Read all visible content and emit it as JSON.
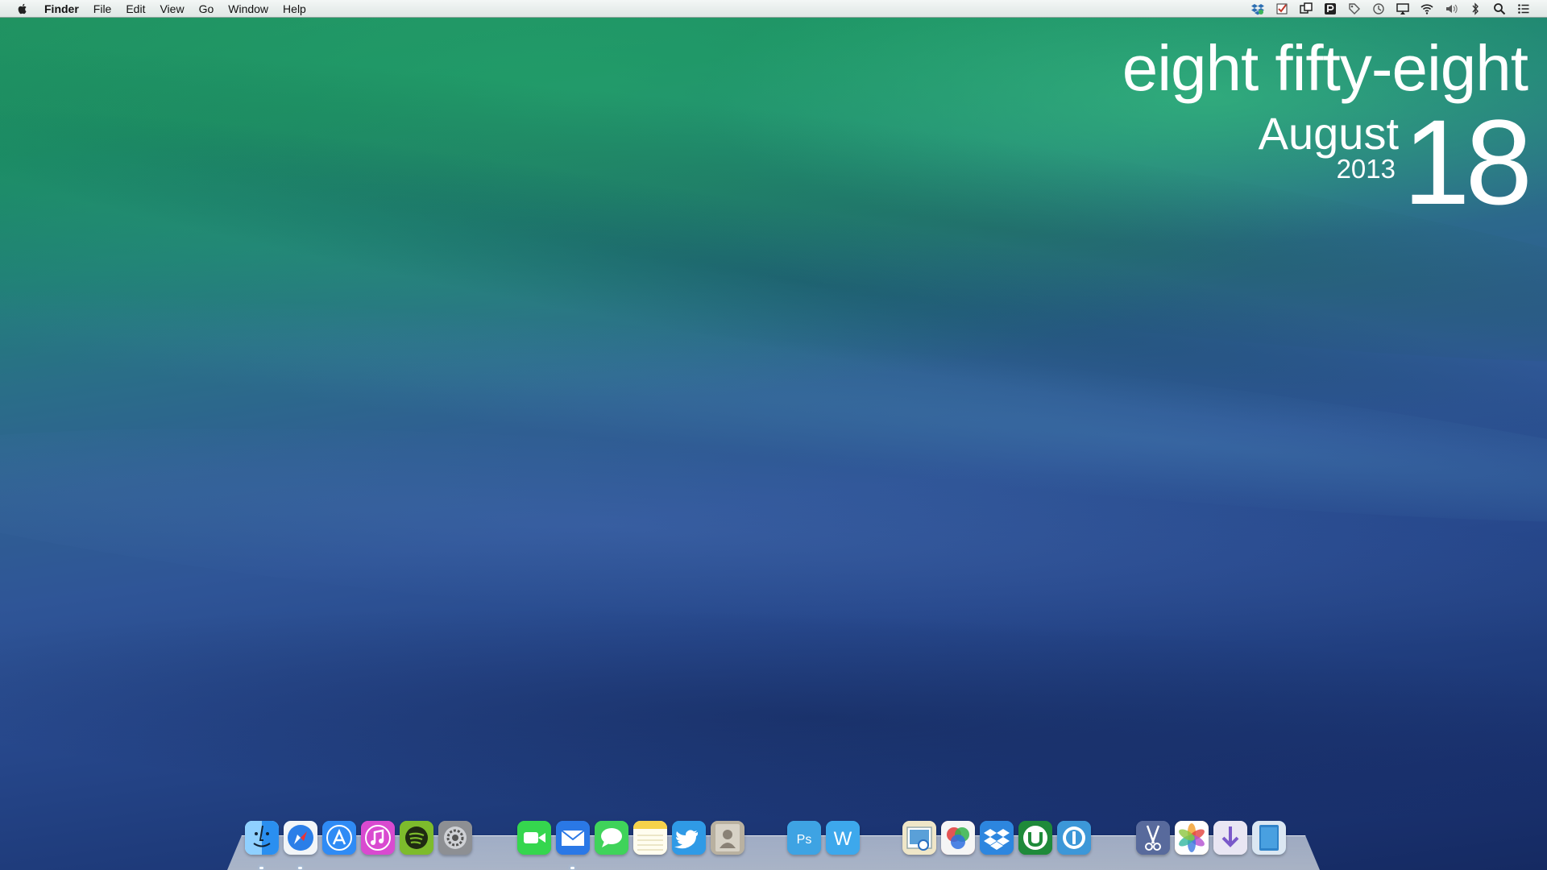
{
  "menubar": {
    "apple_icon": "apple-icon",
    "app_name": "Finder",
    "menus": [
      "File",
      "Edit",
      "View",
      "Go",
      "Window",
      "Help"
    ],
    "status_icons": [
      "dropbox-icon",
      "checklist-icon",
      "window-icon",
      "app-badge-icon",
      "tag-icon",
      "time-machine-icon",
      "airplay-icon",
      "wifi-icon",
      "volume-icon",
      "bluetooth-icon",
      "spotlight-search-icon",
      "notification-center-icon"
    ]
  },
  "clock_widget": {
    "time_text": "eight fifty-eight",
    "month": "August",
    "year": "2013",
    "day": "18"
  },
  "dock": {
    "apps": [
      {
        "name": "finder-icon",
        "color": "#2a8ff0"
      },
      {
        "name": "safari-icon",
        "color": "#2b7ee8"
      },
      {
        "name": "app-store-icon",
        "color": "#2f8bf5"
      },
      {
        "name": "itunes-icon",
        "color": "#d94ad0"
      },
      {
        "name": "spotify-icon",
        "color": "#7dbb2c"
      },
      {
        "name": "system-preferences-icon",
        "color": "#8d8f93"
      },
      {
        "name": "facetime-icon",
        "color": "#35d64e"
      },
      {
        "name": "mail-icon",
        "color": "#2a78e6"
      },
      {
        "name": "messages-icon",
        "color": "#3fd35a"
      },
      {
        "name": "notes-icon",
        "color": "#f6d24a"
      },
      {
        "name": "twitter-icon",
        "color": "#2f9ae6"
      },
      {
        "name": "contacts-icon",
        "color": "#9a9a9a"
      },
      {
        "name": "photoshop-icon",
        "color": "#3ea3e3"
      },
      {
        "name": "word-icon",
        "color": "#3da8ec"
      },
      {
        "name": "preview-icon",
        "color": "#d9c58a"
      },
      {
        "name": "color-picker-icon",
        "color": "#e24343"
      },
      {
        "name": "dropbox-app-icon",
        "color": "#2d86df"
      },
      {
        "name": "utorrent-icon",
        "color": "#1f8a3a"
      },
      {
        "name": "onepassword-icon",
        "color": "#3c97d8"
      },
      {
        "name": "utilities-icon",
        "color": "#586a9c"
      },
      {
        "name": "photos-icon",
        "color": "#f3a233"
      },
      {
        "name": "downloads-icon",
        "color": "#e9e6f3"
      },
      {
        "name": "documents-icon",
        "color": "#2f83c9"
      }
    ],
    "running": [
      "finder-icon",
      "safari-icon",
      "mail-icon"
    ]
  }
}
